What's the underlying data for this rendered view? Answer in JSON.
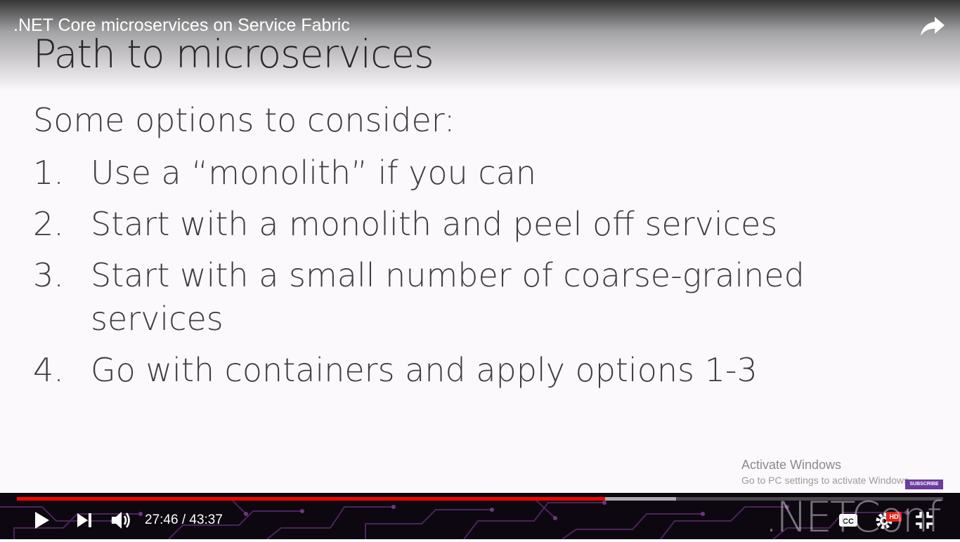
{
  "player": {
    "video_title": ".NET Core microservices on Service Fabric",
    "time_current": "27:46",
    "time_separator": "/",
    "time_total": "43:37",
    "progress_fraction": 0.635,
    "buffer_fraction": 0.712,
    "hd_badge": "HD",
    "accent_color": "#ff0000",
    "icons": [
      "share-icon",
      "play-icon",
      "next-icon",
      "volume-icon",
      "captions-icon",
      "settings-icon",
      "exit-fullscreen-icon"
    ]
  },
  "slide": {
    "title": "Path to microservices",
    "subtitle": "Some options to consider:",
    "items": [
      {
        "number": "1.",
        "text": "Use a “monolith” if you can"
      },
      {
        "number": "2.",
        "text": "Start with a monolith and peel off services"
      },
      {
        "number": "3.",
        "text": "Start with a small number of coarse-grained services"
      },
      {
        "number": "4.",
        "text": "Go with containers and apply options 1-3"
      }
    ]
  },
  "watermark": {
    "line1": "Activate Windows",
    "line2": "Go to PC settings to activate Windows.",
    "subscribe_label": "SUBSCRIBE",
    "brand": ".NETConf"
  }
}
